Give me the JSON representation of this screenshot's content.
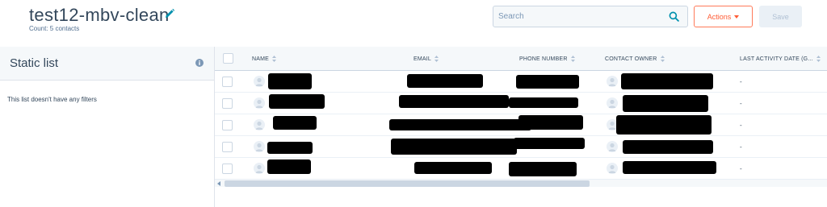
{
  "header": {
    "title": "test12-mbv-clean",
    "count": "Count: 5 contacts",
    "edit_icon": "pencil-icon"
  },
  "search": {
    "placeholder": "Search",
    "icon": "search-icon"
  },
  "toolbar": {
    "actions_label": "Actions",
    "save_label": "Save"
  },
  "left_panel": {
    "title": "Static list",
    "info_icon": "info-icon",
    "empty_text": "This list doesn't have any filters"
  },
  "table": {
    "columns": [
      "NAME",
      "EMAIL",
      "PHONE NUMBER",
      "CONTACT OWNER",
      "LAST ACTIVITY DATE (G..."
    ],
    "rows": [
      {
        "last_activity": "-"
      },
      {
        "last_activity": "-"
      },
      {
        "last_activity": "-"
      },
      {
        "last_activity": "-"
      },
      {
        "last_activity": "-"
      }
    ]
  },
  "colors": {
    "accent": "#ff7a59",
    "text": "#33475b",
    "panel_bg": "#f5f8fa",
    "border": "#cbd6e2",
    "search_icon": "#0091ae"
  }
}
